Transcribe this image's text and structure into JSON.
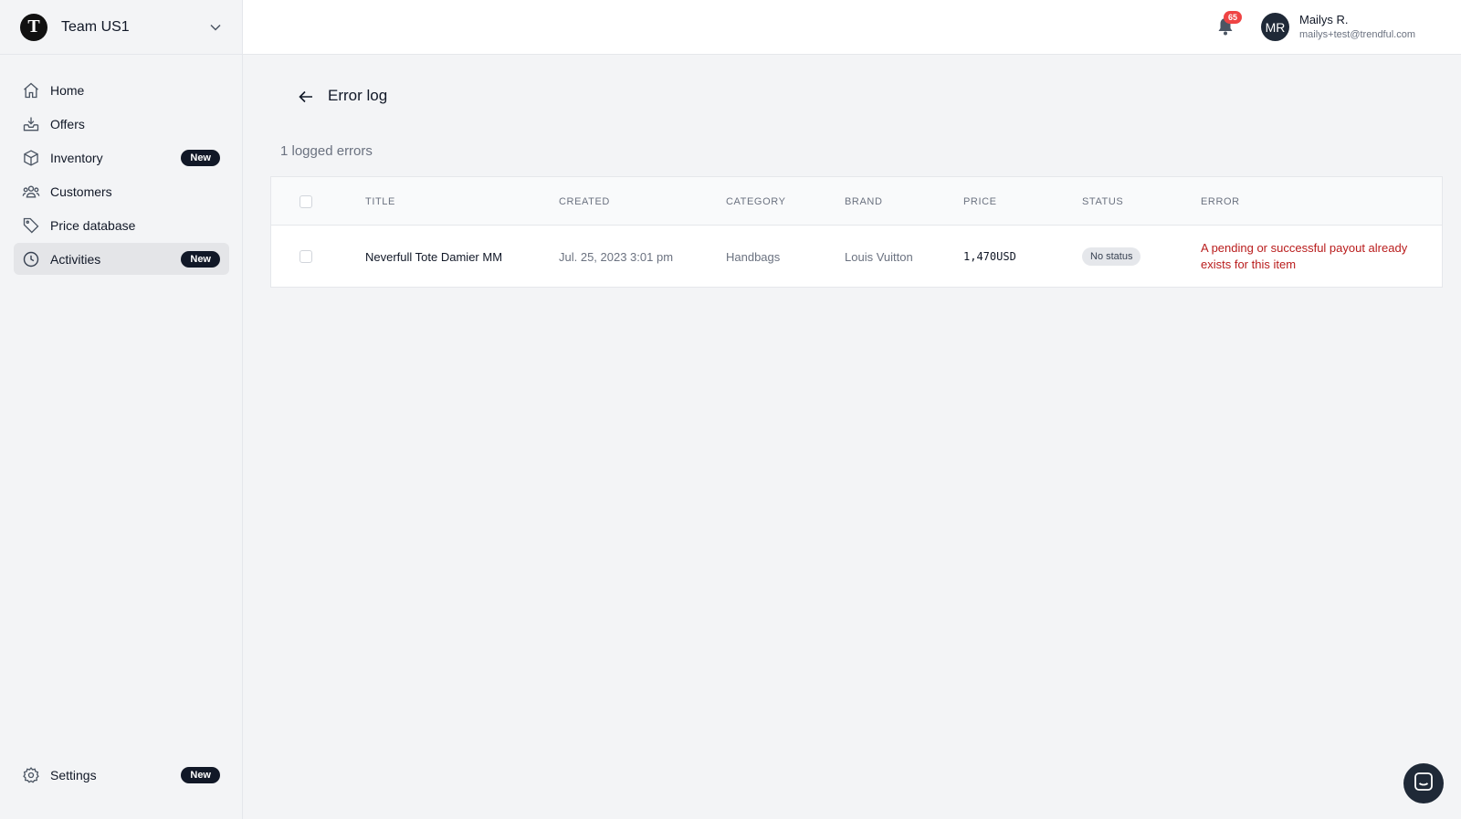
{
  "team": {
    "logo_letter": "T",
    "name": "Team US1"
  },
  "nav": {
    "items": [
      {
        "label": "Home",
        "icon": "home-icon"
      },
      {
        "label": "Offers",
        "icon": "inbox-icon"
      },
      {
        "label": "Inventory",
        "icon": "cube-icon",
        "badge": "New"
      },
      {
        "label": "Customers",
        "icon": "users-icon"
      },
      {
        "label": "Price database",
        "icon": "tag-icon"
      },
      {
        "label": "Activities",
        "icon": "clock-icon",
        "badge": "New",
        "active": true
      }
    ],
    "settings": {
      "label": "Settings",
      "icon": "gear-icon",
      "badge": "New"
    }
  },
  "header": {
    "notification_count": "65",
    "user": {
      "initials": "MR",
      "name": "Mailys R.",
      "email": "mailys+test@trendful.com"
    }
  },
  "page": {
    "title": "Error log",
    "count_text": "1 logged errors"
  },
  "table": {
    "columns": [
      "TITLE",
      "CREATED",
      "CATEGORY",
      "BRAND",
      "PRICE",
      "STATUS",
      "ERROR"
    ],
    "rows": [
      {
        "title": "Neverfull Tote Damier MM",
        "created": "Jul. 25, 2023 3:01 pm",
        "category": "Handbags",
        "brand": "Louis Vuitton",
        "price": "1,470USD",
        "status": "No status",
        "error": "A pending or successful payout already exists for this item"
      }
    ]
  },
  "colors": {
    "accent": "#111827",
    "error": "#b91c1c",
    "notification": "#ef4444"
  }
}
